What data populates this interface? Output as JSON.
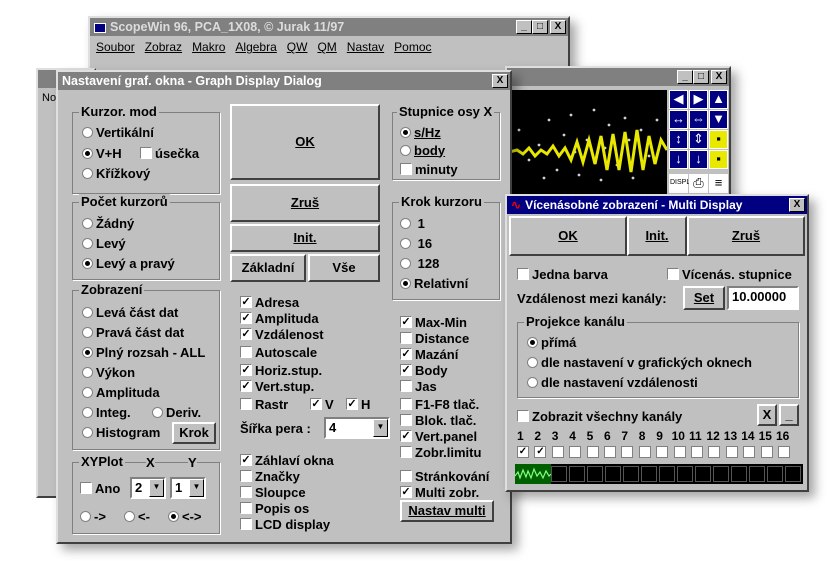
{
  "scopewin": {
    "title": "ScopeWin 96, PCA_1X08, © Jurak 11/97",
    "menu": [
      "Soubor",
      "Zobraz",
      "Makro",
      "Algebra",
      "QW",
      "QM",
      "Nastav",
      "Pomoc"
    ]
  },
  "bgwin": {
    "left_label": "No"
  },
  "graph": {
    "title": "Nastavení graf. okna - Graph Display Dialog",
    "close": "X",
    "kurzor_mod": {
      "label": "Kurzor. mod",
      "vertikalni": "Vertikální",
      "vh": "V+H",
      "usecka": "úsečka",
      "krizkovy": "Křížkový"
    },
    "pocet": {
      "label": "Počet kurzorů",
      "zadny": "Žádný",
      "levy": "Levý",
      "levy_pravy": "Levý a pravý"
    },
    "zobrazeni": {
      "label": "Zobrazení",
      "leva": "Levá část dat",
      "prava": "Pravá část dat",
      "plny": "Plný rozsah - ALL",
      "vykon": "Výkon",
      "amplituda": "Amplituda",
      "integ": "Integ.",
      "deriv": "Deriv.",
      "histogram": "Histogram",
      "krok": "Krok"
    },
    "xyplot": {
      "label": "XYPlot",
      "x": "X",
      "y": "Y",
      "ano": "Ano",
      "xval": "2",
      "yval": "1",
      "r1": "->",
      "r2": "<-",
      "r3": "<->"
    },
    "buttons": {
      "ok": "OK",
      "zrus": "Zruš",
      "init": "Init.",
      "zakladni": "Základní",
      "vse": "Vše"
    },
    "mid": {
      "adresa": "Adresa",
      "amplituda": "Amplituda",
      "vzdalenost": "Vzdálenost",
      "autoscale": "Autoscale",
      "horiz": "Horiz.stup.",
      "vert": "Vert.stup.",
      "rastr": "Rastr",
      "v": "V",
      "h": "H",
      "sirka": "Šířka pera :",
      "sirka_val": "4",
      "zahlavi": "Záhlaví okna",
      "znacky": "Značky",
      "sloupce": "Sloupce",
      "popis": "Popis os",
      "lcd": "LCD display"
    },
    "stupnice": {
      "label": "Stupnice osy X",
      "shz": "s/Hz",
      "body": "body",
      "minuty": "minuty"
    },
    "krok": {
      "label": "Krok kurzoru",
      "k1": "1",
      "k16": "16",
      "k128": "128",
      "rel": "Relativní"
    },
    "right": {
      "maxmin": "Max-Min",
      "distance": "Distance",
      "mazani": "Mazání",
      "body": "Body",
      "jas": "Jas",
      "f1f8": "F1-F8 tlač.",
      "blok": "Blok. tlač.",
      "vertpanel": "Vert.panel",
      "zobrlim": "Zobr.limitu",
      "strank": "Stránkování",
      "multi": "Multi zobr.",
      "nastav": "Nastav multi"
    }
  },
  "multi": {
    "title": "Vícenásobné zobrazení - Multi Display",
    "close": "X",
    "ok": "OK",
    "init": "Init.",
    "zrus": "Zruš",
    "jedna": "Jedna barva",
    "vicenas": "Vícenás. stupnice",
    "vzdal": "Vzdálenost mezi kanály:",
    "set": "Set",
    "vzdal_val": "10.00000",
    "proj": "Projekce kanálu",
    "prima": "přímá",
    "dle_graf": "dle nastavení v grafických oknech",
    "dle_vzdal": "dle nastavení vzdálenosti",
    "vsechny": "Zobrazit všechny kanály",
    "x": "X",
    "dash": "_",
    "channels": [
      "1",
      "2",
      "3",
      "4",
      "5",
      "6",
      "7",
      "8",
      "9",
      "10",
      "11",
      "12",
      "13",
      "14",
      "15",
      "16"
    ]
  },
  "scope": {
    "title": "",
    "controls": [
      "_",
      "□",
      "X"
    ]
  }
}
